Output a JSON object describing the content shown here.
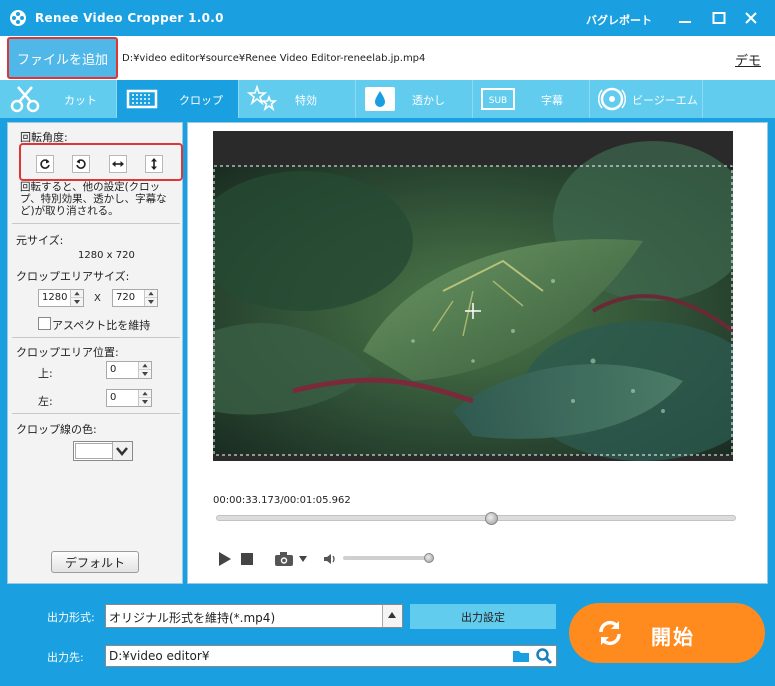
{
  "app": {
    "title": "Renee Video Cropper 1.0.0",
    "bug_report": "バグレポート"
  },
  "file": {
    "add_button": "ファイルを追加",
    "path": "D:¥video editor¥source¥Renee Video Editor-reneelab.jp.mp4",
    "demo_link": "デモ"
  },
  "tabs": [
    {
      "label": "カット",
      "icon": "cut-icon"
    },
    {
      "label": "クロップ",
      "icon": "crop-icon",
      "active": true
    },
    {
      "label": "特効",
      "icon": "effects-icon"
    },
    {
      "label": "透かし",
      "icon": "watermark-icon"
    },
    {
      "label": "字幕",
      "icon": "subtitle-icon"
    },
    {
      "label": "ビージーエム",
      "icon": "bgm-icon"
    }
  ],
  "left": {
    "rotation_label": "回転角度:",
    "rotation_note": "回転すると、他の設定(クロップ、特別効果、透かし、字幕など)が取り消される。",
    "original_size_label": "元サイズ:",
    "original_size": "1280 x 720",
    "crop_size_label": "クロップエリアサイズ:",
    "crop_width": "1280",
    "crop_x": "X",
    "crop_height": "720",
    "aspect_label": "アスペクト比を維持",
    "crop_position_label": "クロップエリア位置:",
    "top_label": "上:",
    "top_value": "0",
    "left_label": "左:",
    "left_value": "0",
    "line_color_label": "クロップ線の色:",
    "default_button": "デフォルト"
  },
  "player": {
    "current_time": "00:00:33.173",
    "separator": "/",
    "total_time": "00:01:05.962",
    "seek_position": 0.53,
    "volume": 1.0
  },
  "bottom": {
    "format_label": "出力形式:",
    "format_value": "オリジナル形式を維持(*.mp4)",
    "output_settings": "出力設定",
    "dest_label": "出力先:",
    "dest_value": "D:¥video editor¥",
    "start_button": "開始"
  },
  "colors": {
    "accent": "#1aa0e0",
    "tab_bg": "#62ccef",
    "start": "#ff8a1e",
    "highlight": "#e03535"
  }
}
